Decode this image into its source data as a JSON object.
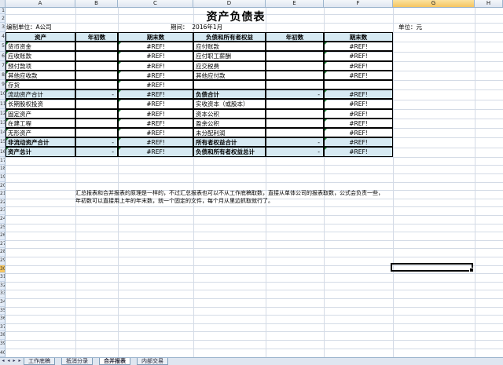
{
  "columns": [
    "A",
    "B",
    "C",
    "D",
    "E",
    "F",
    "G",
    "H"
  ],
  "active_column": "G",
  "rows": [
    "1",
    "2",
    "3",
    "4",
    "5",
    "6",
    "7",
    "8",
    "9",
    "10",
    "11",
    "12",
    "13",
    "14",
    "15",
    "16",
    "17",
    "18",
    "19",
    "20",
    "21",
    "22",
    "23",
    "24",
    "25",
    "26",
    "27",
    "28",
    "29",
    "30",
    "31",
    "32",
    "33",
    "34",
    "35",
    "36",
    "37",
    "38",
    "39",
    "40"
  ],
  "active_row": "30",
  "title": "资产负债表",
  "meta": {
    "company_label": "编制单位：",
    "company_value": "A公司",
    "period_label": "期间：",
    "period_value": "2016年1月",
    "unit_label": "单位：元"
  },
  "headers": {
    "asset": "资产",
    "begin": "年初数",
    "end": "期末数",
    "liab": "负债和所有者权益",
    "begin2": "年初数",
    "end2": "期末数"
  },
  "table_rows": [
    {
      "asset": "货币资金",
      "begin": "",
      "end": "#REF!",
      "liab": "应付账款",
      "begin2": "",
      "end2": "#REF!"
    },
    {
      "asset": "应收账款",
      "begin": "",
      "end": "#REF!",
      "liab": "应付职工薪酬",
      "begin2": "",
      "end2": "#REF!"
    },
    {
      "asset": "预付款项",
      "begin": "",
      "end": "#REF!",
      "liab": "应交税费",
      "begin2": "",
      "end2": "#REF!"
    },
    {
      "asset": "其他应收款",
      "begin": "",
      "end": "#REF!",
      "liab": "其他应付款",
      "begin2": "",
      "end2": "#REF!"
    },
    {
      "asset": "存货",
      "begin": "",
      "end": "#REF!",
      "liab": "",
      "begin2": "",
      "end2": ""
    },
    {
      "asset": "流动资产合计",
      "begin": "-",
      "end": "#REF!",
      "liab": "负债合计",
      "begin2": "-",
      "end2": "#REF!"
    },
    {
      "asset": "长期股权投资",
      "begin": "",
      "end": "#REF!",
      "liab": "实收资本（或股本）",
      "begin2": "",
      "end2": "#REF!"
    },
    {
      "asset": "固定资产",
      "begin": "",
      "end": "#REF!",
      "liab": "资本公积",
      "begin2": "",
      "end2": "#REF!"
    },
    {
      "asset": "在建工程",
      "begin": "",
      "end": "#REF!",
      "liab": "盈余公积",
      "begin2": "",
      "end2": "#REF!"
    },
    {
      "asset": "无形资产",
      "begin": "",
      "end": "#REF!",
      "liab": "未分配利润",
      "begin2": "",
      "end2": "#REF!"
    },
    {
      "asset": "非流动资产合计",
      "begin": "-",
      "end": "#REF!",
      "liab": "所有者权益合计",
      "begin2": "-",
      "end2": "#REF!"
    },
    {
      "asset": "资产总计",
      "begin": "-",
      "end": "#REF!",
      "liab": "负债和所有者权益总计",
      "begin2": "-",
      "end2": "#REF!"
    }
  ],
  "notes": {
    "line1": "汇总报表和合并报表的原理是一样的，不过汇总报表也可以不从工作底稿取数，直接从单体公司的报表取数，公式会负责一些，",
    "line2": "年初数可以直接用上年的年末数，就一个固定的文件，每个月从里边抓取就行了。"
  },
  "sheet_tabs": [
    "工作底稿",
    "抵消分录",
    "合并报表",
    "内部交易"
  ],
  "active_tab": "合并报表"
}
